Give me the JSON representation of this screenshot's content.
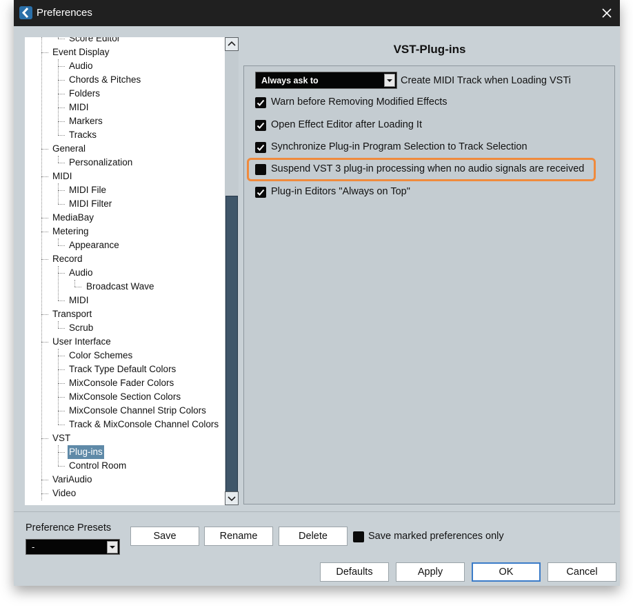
{
  "window": {
    "title": "Preferences"
  },
  "tree": {
    "items": [
      {
        "label": "Score Editor",
        "level": 1
      },
      {
        "label": "Event Display",
        "level": 0
      },
      {
        "label": "Audio",
        "level": 1
      },
      {
        "label": "Chords & Pitches",
        "level": 1
      },
      {
        "label": "Folders",
        "level": 1
      },
      {
        "label": "MIDI",
        "level": 1
      },
      {
        "label": "Markers",
        "level": 1
      },
      {
        "label": "Tracks",
        "level": 1
      },
      {
        "label": "General",
        "level": 0
      },
      {
        "label": "Personalization",
        "level": 1
      },
      {
        "label": "MIDI",
        "level": 0
      },
      {
        "label": "MIDI File",
        "level": 1
      },
      {
        "label": "MIDI Filter",
        "level": 1
      },
      {
        "label": "MediaBay",
        "level": 0
      },
      {
        "label": "Metering",
        "level": 0
      },
      {
        "label": "Appearance",
        "level": 1
      },
      {
        "label": "Record",
        "level": 0
      },
      {
        "label": "Audio",
        "level": 1
      },
      {
        "label": "Broadcast Wave",
        "level": 2
      },
      {
        "label": "MIDI",
        "level": 1
      },
      {
        "label": "Transport",
        "level": 0
      },
      {
        "label": "Scrub",
        "level": 1
      },
      {
        "label": "User Interface",
        "level": 0
      },
      {
        "label": "Color Schemes",
        "level": 1
      },
      {
        "label": "Track Type Default Colors",
        "level": 1
      },
      {
        "label": "MixConsole Fader Colors",
        "level": 1
      },
      {
        "label": "MixConsole Section Colors",
        "level": 1
      },
      {
        "label": "MixConsole Channel Strip Colors",
        "level": 1
      },
      {
        "label": "Track & MixConsole Channel Colors",
        "level": 1
      },
      {
        "label": "VST",
        "level": 0
      },
      {
        "label": "Plug-ins",
        "level": 1,
        "selected": true
      },
      {
        "label": "Control Room",
        "level": 1
      },
      {
        "label": "VariAudio",
        "level": 0
      },
      {
        "label": "Video",
        "level": 0
      }
    ]
  },
  "main": {
    "section_title": "VST-Plug-ins",
    "dropdown": {
      "value": "Always ask to",
      "label": "Create MIDI Track when Loading VSTi"
    },
    "options": [
      {
        "label": "Warn before Removing Modified Effects",
        "checked": true
      },
      {
        "label": "Open Effect Editor after Loading It",
        "checked": true
      },
      {
        "label": "Synchronize Plug-in Program Selection to Track Selection",
        "checked": true
      },
      {
        "label": "Suspend VST 3 plug-in processing when no audio signals are received",
        "checked": false,
        "highlighted": true
      },
      {
        "label": "Plug-in Editors \"Always on Top\"",
        "checked": true
      }
    ]
  },
  "footer": {
    "presets_label": "Preference Presets",
    "presets_value": "-",
    "save_label": "Save",
    "rename_label": "Rename",
    "delete_label": "Delete",
    "save_marked_label": "Save marked preferences only",
    "save_marked_checked": false,
    "defaults_label": "Defaults",
    "apply_label": "Apply",
    "ok_label": "OK",
    "cancel_label": "Cancel"
  },
  "colors": {
    "window_bg": "#c9d1d6",
    "titlebar_bg": "#202020",
    "selection": "#5f8aa8",
    "highlight_outline": "#f08a3c"
  }
}
